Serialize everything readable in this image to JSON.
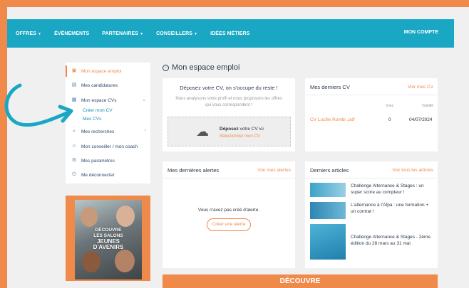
{
  "nav": {
    "items": [
      "OFFRES",
      "ÉVÈNEMENTS",
      "PARTENAIRES",
      "CONSEILLERS",
      "IDÉES MÉTIERS"
    ],
    "account": "MON COMPTE"
  },
  "sidebar": {
    "items": [
      {
        "label": "Mon espace emploi",
        "icon": "briefcase-icon"
      },
      {
        "label": "Mes candidatures",
        "icon": "document-icon"
      },
      {
        "label": "Mon espace CVs",
        "icon": "cv-icon"
      },
      {
        "label": "Mes recherches",
        "icon": "search-icon"
      },
      {
        "label": "Mon conseiller / mon coach",
        "icon": "users-icon"
      },
      {
        "label": "Mes paramètres",
        "icon": "gear-icon"
      },
      {
        "label": "Me déconnecter",
        "icon": "power-icon"
      }
    ],
    "sub": [
      "Créer mon CV",
      "Mes CVs"
    ]
  },
  "promo": {
    "line1": "DÉCOUVRE",
    "line2": "LES SALONS",
    "line3": "JEUNES",
    "line4": "D'AVENIRS"
  },
  "page_title": "Mon espace emploi",
  "upload": {
    "title": "Déposez votre CV, on s'occupe du reste !",
    "desc": "Nous analysons votre profil et nous proposons les offres qui vous correspondent !",
    "drop_bold": "Déposez",
    "drop_rest": " votre CV ici",
    "select": "Sélectionner mon CV"
  },
  "cvs": {
    "title": "Mes derniers CV",
    "link": "Voir mes CV",
    "col_views": "Vues",
    "col_valid": "Validité",
    "row": {
      "name": "CV Lucille Rombi .pdf",
      "views": "0",
      "date": "04/07/2024"
    }
  },
  "alerts": {
    "title": "Mes dernières alertes",
    "link": "Voir mes alertes",
    "empty": "Vous n'avez pas créé d'alerte.",
    "button": "Créer une alerte"
  },
  "articles": {
    "title": "Derniers articles",
    "link": "Voir tous les articles",
    "items": [
      "Challenge Alternance & Stages : un super score au compteur !",
      "L'alternance à l'Afpa : une formation + un contrat !",
      "Challenge Alternance & Stages - 2ème édition du 28 mars au 31 mai"
    ]
  },
  "banner": "DÉCOUVRE"
}
